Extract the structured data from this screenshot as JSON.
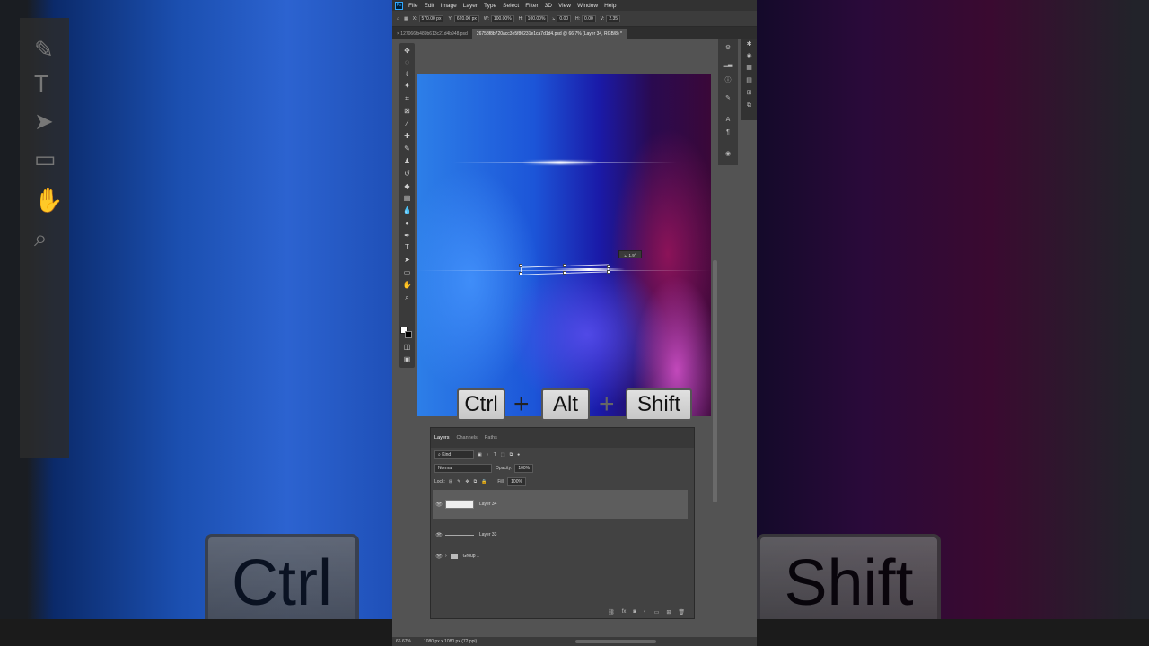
{
  "menu": [
    "File",
    "Edit",
    "Image",
    "Layer",
    "Type",
    "Select",
    "Filter",
    "3D",
    "View",
    "Window",
    "Help"
  ],
  "options": {
    "x_label": "X:",
    "x_value": "570.00 px",
    "y_label": "Y:",
    "y_value": "620.00 px",
    "w_label": "W:",
    "w_value": "100.00%",
    "h_label": "H:",
    "h_value": "100.00%",
    "angle_value": "0.00",
    "h_skew_label": "H:",
    "h_skew_value": "0.00",
    "v_skew_label": "V:",
    "v_skew_value": "2.35"
  },
  "tabs": [
    {
      "label": "× 127066fb489b613c21d4b948.psd"
    },
    {
      "label": "26758f8b720acc3e5f80231e1ca7d1d4.psd @ 66.7% (Layer 34, RGB/8) *"
    }
  ],
  "transform_tooltip": "⦣: 1.9°",
  "keys": {
    "ctrl": "Ctrl",
    "alt": "Alt",
    "shift": "Shift",
    "plus": "+"
  },
  "layers_panel": {
    "tabs": [
      "Layers",
      "Channels",
      "Paths"
    ],
    "filter_kind": "Kind",
    "blend_mode": "Normal",
    "opacity_label": "Opacity:",
    "opacity_value": "100%",
    "lock_label": "Lock:",
    "fill_label": "Fill:",
    "fill_value": "100%",
    "layers": [
      {
        "name": "Layer 34",
        "selected": true
      },
      {
        "name": "Layer 33",
        "selected": false
      },
      {
        "name": "Group 1",
        "selected": false
      }
    ]
  },
  "status": {
    "zoom": "66.67%",
    "doc_size": "1080 px x 1080 px (72 ppi)"
  }
}
